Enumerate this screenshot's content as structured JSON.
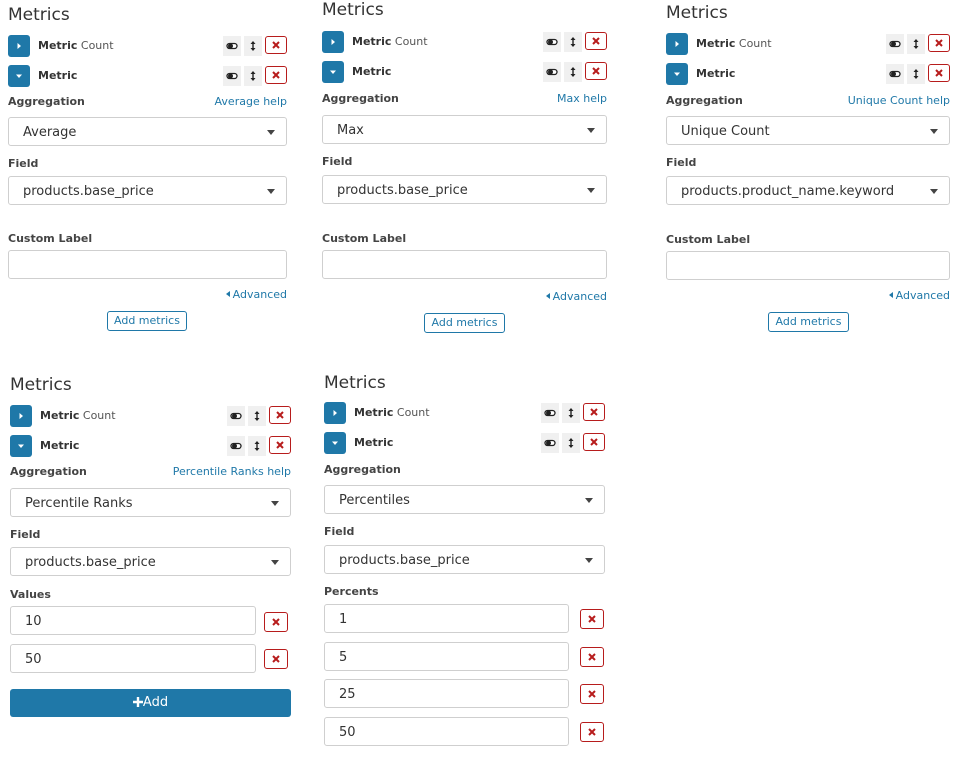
{
  "labels": {
    "panel_title": "Metrics",
    "metric": "Metric",
    "count": "Count",
    "aggregation": "Aggregation",
    "field": "Field",
    "custom_label": "Custom Label",
    "advanced": "Advanced",
    "add_metrics": "Add metrics",
    "values": "Values",
    "percents": "Percents",
    "add": "Add"
  },
  "panels": [
    {
      "help": "Average help",
      "aggregation": "Average",
      "field": "products.base_price",
      "custom_label_value": ""
    },
    {
      "help": "Max help",
      "aggregation": "Max",
      "field": "products.base_price",
      "custom_label_value": ""
    },
    {
      "help": "Unique Count help",
      "aggregation": "Unique Count",
      "field": "products.product_name.keyword",
      "custom_label_value": ""
    },
    {
      "help": "Percentile Ranks help",
      "aggregation": "Percentile Ranks",
      "field": "products.base_price",
      "values": [
        "10",
        "50"
      ]
    },
    {
      "help": "",
      "aggregation": "Percentiles",
      "field": "products.base_price",
      "percents": [
        "1",
        "5",
        "25",
        "50"
      ]
    }
  ],
  "colors": {
    "accent": "#1f78a8",
    "danger": "#b71c1c",
    "border": "#cfcfcf"
  },
  "icons": {
    "expand": "chevron-right-icon",
    "collapse": "chevron-down-icon",
    "toggle": "toggle-icon",
    "reorder": "sort-icon",
    "remove": "close-icon",
    "add": "plus-icon"
  }
}
